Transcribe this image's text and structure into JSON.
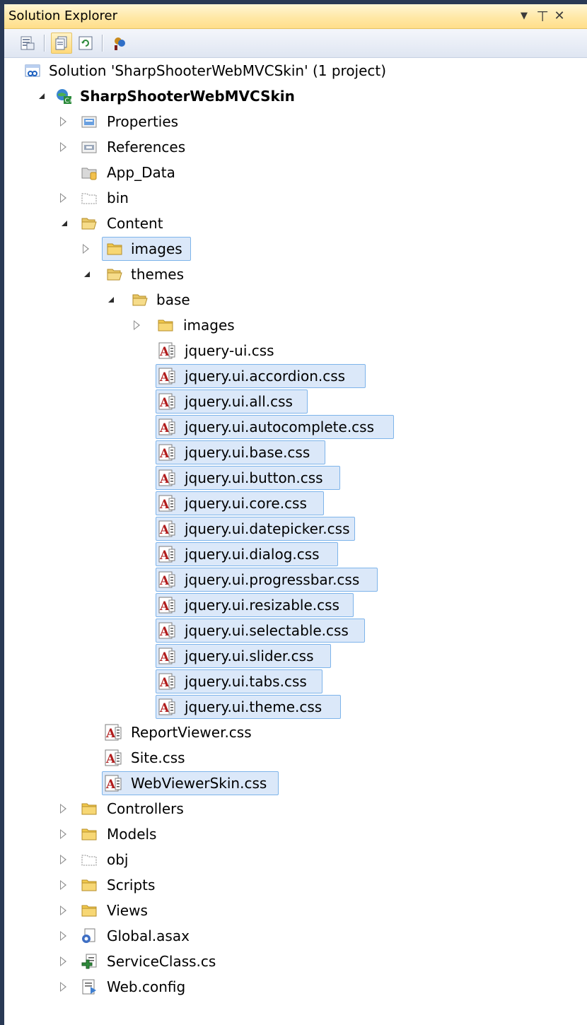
{
  "window": {
    "title": "Solution Explorer",
    "dropdown_glyph": "▼",
    "pin_glyph": "⊥",
    "close_glyph": "✕"
  },
  "toolbar": {
    "buttons": [
      {
        "name": "properties-icon",
        "pressed": false
      },
      {
        "name": "show-all-files-icon",
        "pressed": true
      },
      {
        "name": "refresh-icon",
        "pressed": false
      },
      {
        "name": "class-diagram-icon",
        "pressed": false
      }
    ]
  },
  "tree": {
    "solution": "Solution 'SharpShooterWebMVCSkin' (1 project)",
    "project": "SharpShooterWebMVCSkin",
    "properties": "Properties",
    "references": "References",
    "app_data": "App_Data",
    "bin": "bin",
    "content": "Content",
    "content_images": "images",
    "themes": "themes",
    "base": "base",
    "base_images": "images",
    "base_files": [
      "jquery-ui.css",
      "jquery.ui.accordion.css",
      "jquery.ui.all.css",
      "jquery.ui.autocomplete.css",
      "jquery.ui.base.css",
      "jquery.ui.button.css",
      "jquery.ui.core.css",
      "jquery.ui.datepicker.css",
      "jquery.ui.dialog.css",
      "jquery.ui.progressbar.css",
      "jquery.ui.resizable.css",
      "jquery.ui.selectable.css",
      "jquery.ui.slider.css",
      "jquery.ui.tabs.css",
      "jquery.ui.theme.css"
    ],
    "content_files": [
      "ReportViewer.css",
      "Site.css",
      "WebViewerSkin.css"
    ],
    "controllers": "Controllers",
    "models": "Models",
    "obj": "obj",
    "scripts": "Scripts",
    "views": "Views",
    "global": "Global.asax",
    "service": "ServiceClass.cs",
    "webconfig": "Web.config"
  },
  "colors": {
    "selection_fill": "#dbe8f9",
    "selection_border": "#7eb4ea",
    "title_bar": "#ffe8a6",
    "frame": "#293955"
  }
}
